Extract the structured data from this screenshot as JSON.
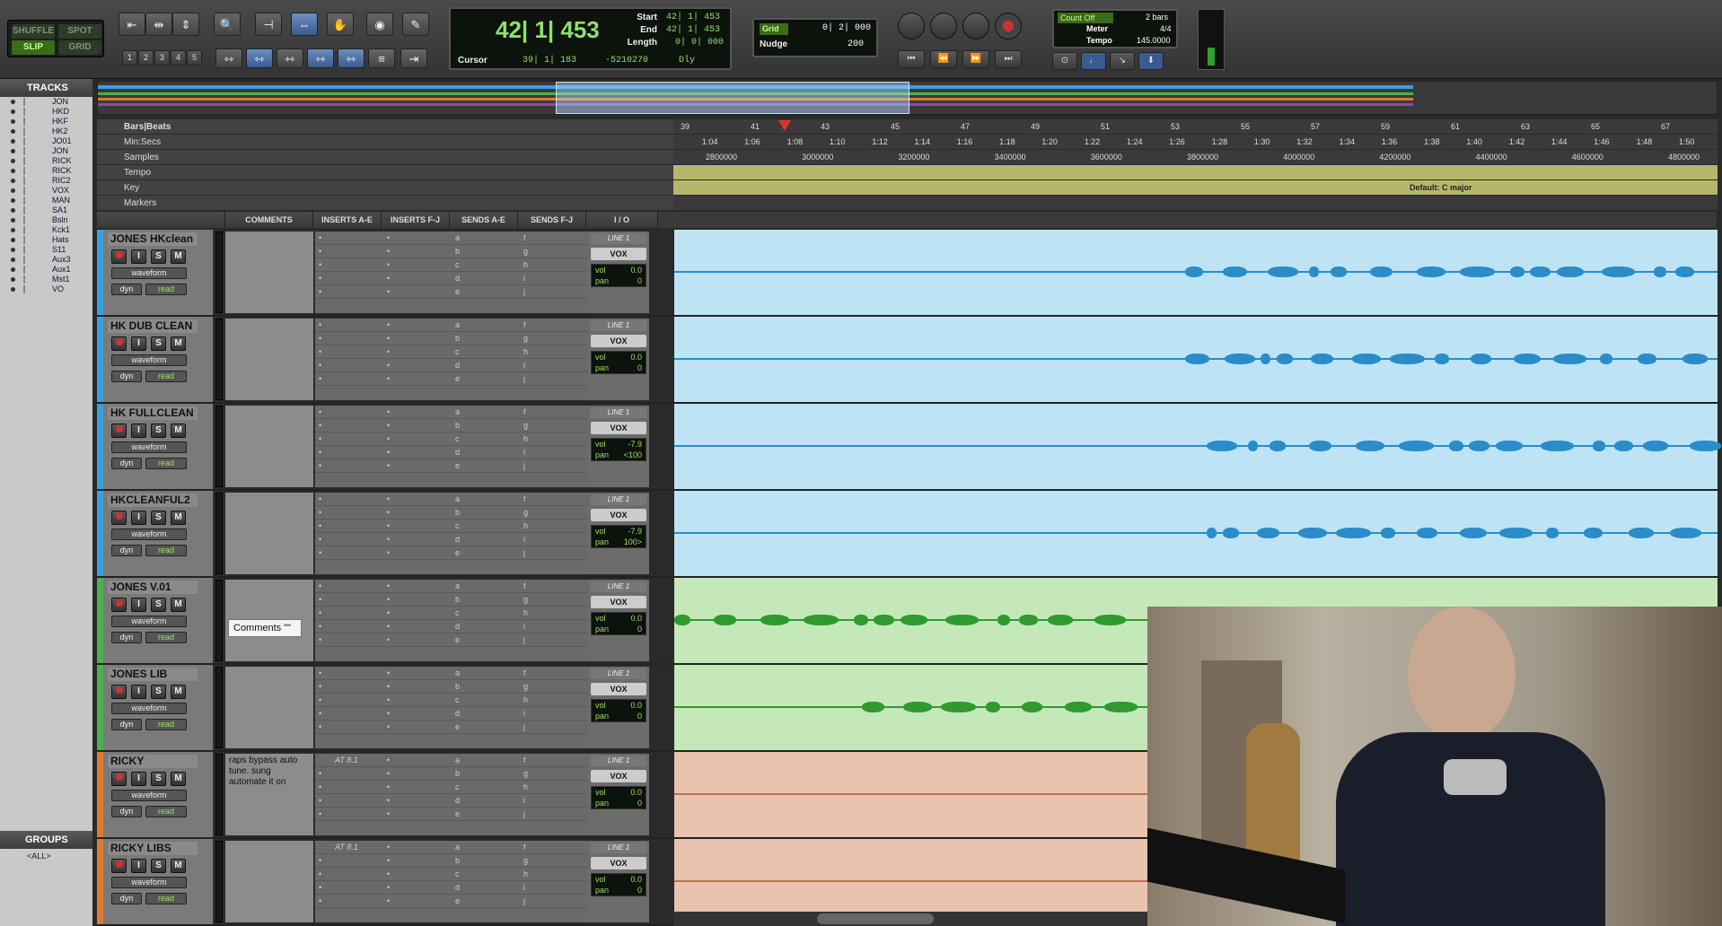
{
  "edit_modes": {
    "shuffle": "SHUFFLE",
    "spot": "SPOT",
    "slip": "SLIP",
    "grid": "GRID"
  },
  "zoom_presets": [
    "1",
    "2",
    "3",
    "4",
    "5"
  ],
  "counter": {
    "main": "42| 1| 453",
    "start_label": "Start",
    "start": "42| 1| 453",
    "end_label": "End",
    "end": "42| 1| 453",
    "length_label": "Length",
    "length": "0| 0| 000",
    "cursor_label": "Cursor",
    "cursor": "39| 1| 183",
    "sample": "-5210270",
    "dly": "Dly"
  },
  "grid": {
    "label": "Grid",
    "value": "0| 2| 000",
    "nudge_label": "Nudge",
    "nudge": "200"
  },
  "count": {
    "countoff": "Count Off",
    "bars": "2 bars",
    "meter_label": "Meter",
    "meter": "4/4",
    "tempo_label": "Tempo",
    "tempo": "145.0000"
  },
  "sidebar": {
    "title": "TRACKS",
    "tracks": [
      "JON",
      "HKD",
      "HKF",
      "HK2",
      "JO01",
      "JON",
      "RICK",
      "RICK",
      "RIC2",
      "VOX",
      "MAN",
      "SA1",
      "Bsln",
      "Kck1",
      "Hats",
      "S11",
      "Aux3",
      "Aux1",
      "Mst1",
      "VO"
    ],
    "groups_title": "GROUPS",
    "groups_all": "<ALL>"
  },
  "rulers": {
    "bars_label": "Bars|Beats",
    "min_label": "Min:Secs",
    "samples_label": "Samples",
    "tempo_label": "Tempo",
    "key_label": "Key",
    "markers_label": "Markers",
    "key_text": "Default: C major",
    "bars": [
      "39",
      "41",
      "43",
      "45",
      "47",
      "49",
      "51",
      "53",
      "55",
      "57",
      "59",
      "61",
      "63",
      "65",
      "67"
    ],
    "mins": [
      "1:04",
      "1:06",
      "1:08",
      "1:10",
      "1:12",
      "1:14",
      "1:16",
      "1:18",
      "1:20",
      "1:22",
      "1:24",
      "1:26",
      "1:28",
      "1:30",
      "1:32",
      "1:34",
      "1:36",
      "1:38",
      "1:40",
      "1:42",
      "1:44",
      "1:46",
      "1:48",
      "1:50"
    ],
    "samples": [
      "2800000",
      "3000000",
      "3200000",
      "3400000",
      "3600000",
      "3800000",
      "4000000",
      "4200000",
      "4400000",
      "4600000",
      "4800000"
    ]
  },
  "columns": {
    "comments": "COMMENTS",
    "inserts_ae": "INSERTS A-E",
    "inserts_fj": "INSERTS F-J",
    "sends_ae": "SENDS A-E",
    "sends_fj": "SENDS F-J",
    "io": "I / O"
  },
  "send_letters_ae": [
    "a",
    "b",
    "c",
    "d",
    "e"
  ],
  "send_letters_fj": [
    "f",
    "g",
    "h",
    "i",
    "j"
  ],
  "track_common": {
    "waveform": "waveform",
    "dyn": "dyn",
    "read": "read",
    "line": "LINE 1",
    "vox": "VOX",
    "vol": "vol",
    "pan": "pan",
    "i": "I",
    "s": "S",
    "m": "M"
  },
  "tracks": [
    {
      "name": "JONES HKclean",
      "vol": "0.0",
      "pan": "0",
      "comment": "",
      "insert": "",
      "color": "#3aa0e0",
      "lane": "#bde3f5",
      "wave": "#2a8cc8"
    },
    {
      "name": "HK DUB CLEAN",
      "vol": "0.0",
      "pan": "0",
      "comment": "",
      "insert": "",
      "color": "#3aa0e0",
      "lane": "#bde3f5",
      "wave": "#2a8cc8"
    },
    {
      "name": "HK FULLCLEAN",
      "vol": "-7.9",
      "pan": "<100",
      "comment": "",
      "insert": "",
      "color": "#3aa0e0",
      "lane": "#bde3f5",
      "wave": "#2a8cc8"
    },
    {
      "name": "HKCLEANFUL2",
      "vol": "-7.9",
      "pan": "100>",
      "comment": "",
      "insert": "",
      "color": "#3aa0e0",
      "lane": "#bde3f5",
      "wave": "#2a8cc8"
    },
    {
      "name": "JONES V.01",
      "vol": "0.0",
      "pan": "0",
      "comment": "",
      "insert": "",
      "color": "#4cb04c",
      "lane": "#c4e8b8",
      "wave": "#2f9a2f"
    },
    {
      "name": "JONES LIB",
      "vol": "0.0",
      "pan": "0",
      "comment": "",
      "insert": "",
      "color": "#4cb04c",
      "lane": "#c4e8b8",
      "wave": "#2f9a2f"
    },
    {
      "name": "RICKY",
      "vol": "0.0",
      "pan": "0",
      "comment": "raps bypass auto tune. sung automate it on",
      "insert": "AT 8.1",
      "color": "#e07a30",
      "lane": "#e9c3ad",
      "wave": "#c07050"
    },
    {
      "name": "RICKY LIBS",
      "vol": "0.0",
      "pan": "0",
      "comment": "",
      "insert": "AT 8.1",
      "color": "#e07a30",
      "lane": "#e9c3ad",
      "wave": "#c07050"
    }
  ],
  "tooltip": "Comments \"\""
}
